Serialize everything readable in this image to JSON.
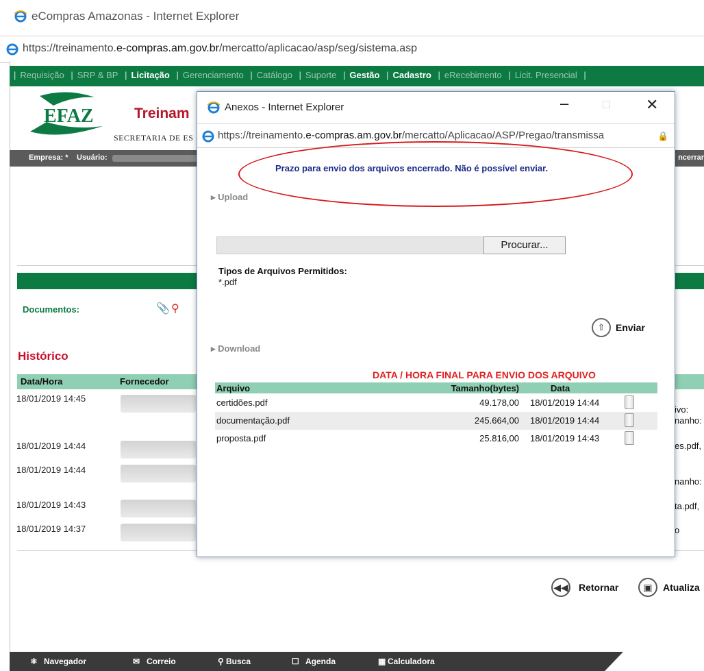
{
  "window": {
    "title": "eCompras Amazonas - Internet Explorer",
    "url_prefix": "https://treinamento.",
    "url_domain": "e-compras.am.gov.br",
    "url_path": "/mercatto/aplicacao/asp/seg/sistema.asp"
  },
  "menu": {
    "items": [
      {
        "label": "Requisição",
        "active": false
      },
      {
        "label": "SRP & BP",
        "active": false
      },
      {
        "label": "Licitação",
        "active": true
      },
      {
        "label": "Gerenciamento",
        "active": false
      },
      {
        "label": "Catálogo",
        "active": false
      },
      {
        "label": "Suporte",
        "active": false
      },
      {
        "label": "Gestão",
        "active": true
      },
      {
        "label": "Cadastro",
        "active": true
      },
      {
        "label": "eRecebimento",
        "active": false
      },
      {
        "label": "Licit. Presencial",
        "active": false
      }
    ]
  },
  "brand": {
    "logo_text": "EFAZ",
    "title": "Treinam",
    "subtitle": "SECRETARIA DE ES"
  },
  "userbar": {
    "empresa": "Empresa: *",
    "usuario": "Usuário:",
    "encerrar": "ncerrar"
  },
  "main": {
    "documentos_label": "Documentos:",
    "historico_title": "Histórico",
    "history_headers": [
      "Data/Hora",
      "Fornecedor"
    ],
    "history_rows": [
      {
        "datetime": "18/01/2019 14:45",
        "right1": "ivo:",
        "right2": "nanho:"
      },
      {
        "datetime": "18/01/2019 14:44",
        "right1": "es.pdf,",
        "right2": ""
      },
      {
        "datetime": "18/01/2019 14:44",
        "right1": "nanho:",
        "right2": ""
      },
      {
        "datetime": "18/01/2019 14:43",
        "right1": "ta.pdf,",
        "right2": ""
      },
      {
        "datetime": "18/01/2019 14:37",
        "right1": "o",
        "right2": ""
      }
    ],
    "retornar_label": "Retornar",
    "atualizar_label": "Atualiza"
  },
  "taskbar": {
    "items": [
      "Navegador",
      "Correio",
      "Busca",
      "Agenda",
      "Calculadora"
    ]
  },
  "popup": {
    "title": "Anexos - Internet Explorer",
    "url_prefix": "https://treinamento.",
    "url_domain": "e-compras.am.gov.br",
    "url_path": "/mercatto/Aplicacao/ASP/Pregao/transmissa",
    "message": "Prazo para envio dos arquivos encerrado. Não é possível enviar.",
    "upload_label": "Upload",
    "browse_label": "Procurar...",
    "allowed_title": "Tipos de Arquivos Permitidos:",
    "allowed_types": "*.pdf",
    "send_label": "Enviar",
    "download_label": "Download",
    "deadline_note": "DATA / HORA FINAL PARA ENVIO DOS ARQUIVO",
    "table_headers": [
      "Arquivo",
      "Tamanho(bytes)",
      "Data"
    ],
    "files": [
      {
        "name": "certidões.pdf",
        "size": "49.178,00",
        "date": "18/01/2019 14:44"
      },
      {
        "name": "documentação.pdf",
        "size": "245.664,00",
        "date": "18/01/2019 14:44"
      },
      {
        "name": "proposta.pdf",
        "size": "25.816,00",
        "date": "18/01/2019 14:43"
      }
    ]
  },
  "colors": {
    "brand_green": "#0d7a43",
    "brand_red": "#b5162a",
    "highlight_red": "#e02020",
    "message_blue": "#1a2a8a",
    "table_header": "#8fcfb3"
  }
}
